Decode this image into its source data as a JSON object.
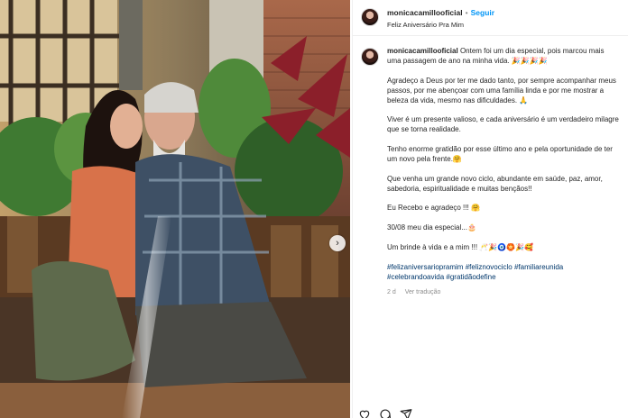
{
  "post": {
    "username": "monicacamillooficial",
    "separator": "•",
    "follow_label": "Seguir",
    "audio_label": "Feliz Aniversário Pra Mim",
    "caption": {
      "p1": "Ontem foi um dia especial, pois marcou mais uma passagem de ano na minha vida. 🎉🎉🎉🎉",
      "p2": "Agradeço a Deus por ter me dado tanto, por sempre acompanhar meus passos, por me abençoar com uma família linda e por me mostrar a beleza da vida, mesmo nas dificuldades. 🙏",
      "p3": "Viver é um presente valioso, e cada aniversário é um verdadeiro milagre que se torna realidade.",
      "p4": "Tenho enorme gratidão por esse último ano e pela oportunidade de ter um novo pela frente.🤗",
      "p5": "Que venha um grande novo ciclo, abundante em saúde, paz, amor, sabedoria, espiritualidade e muitas bençãos!!",
      "p6": "Eu Recebo e agradeço !!! 🤗",
      "p7": "30/08 meu dia especial...🎂",
      "p8": "Um brinde à vida e a mim !!! 🥂🎉🧿🏵️🎉🥰"
    },
    "hashtags": [
      "#felizaniversariopramim",
      "#feliznovociclo",
      "#familiareunida",
      "#celebrandoavida",
      "#gratidãodefine"
    ],
    "time": "2 d",
    "translate_label": "Ver tradução",
    "next_icon": "chevron-right-icon"
  },
  "colors": {
    "link": "#0095f6",
    "hashtag": "#00376b",
    "muted": "#8e8e8e"
  },
  "actions": [
    "heart-icon",
    "comment-icon",
    "share-icon"
  ]
}
